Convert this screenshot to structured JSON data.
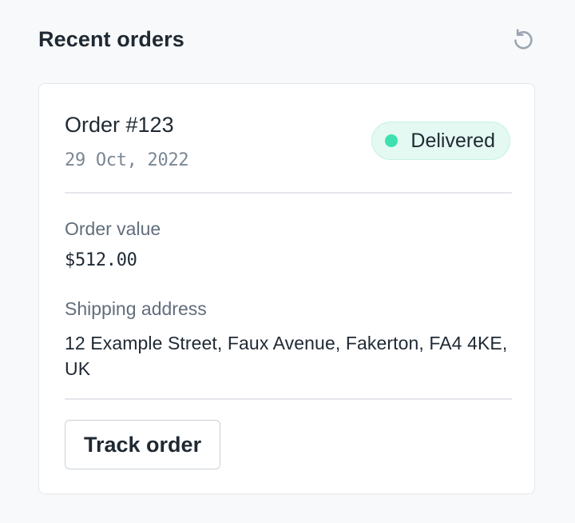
{
  "header": {
    "title": "Recent orders",
    "refresh_icon": "refresh-icon"
  },
  "order": {
    "title": "Order #123",
    "date": "29 Oct, 2022",
    "status": {
      "label": "Delivered",
      "color": "#3ee0b0",
      "background": "#e3f9f1"
    },
    "value_label": "Order value",
    "value": "$512.00",
    "address_label": "Shipping address",
    "address": "12 Example Street, Faux Avenue, Fakerton, FA4 4KE, UK",
    "track_button_label": "Track order"
  }
}
